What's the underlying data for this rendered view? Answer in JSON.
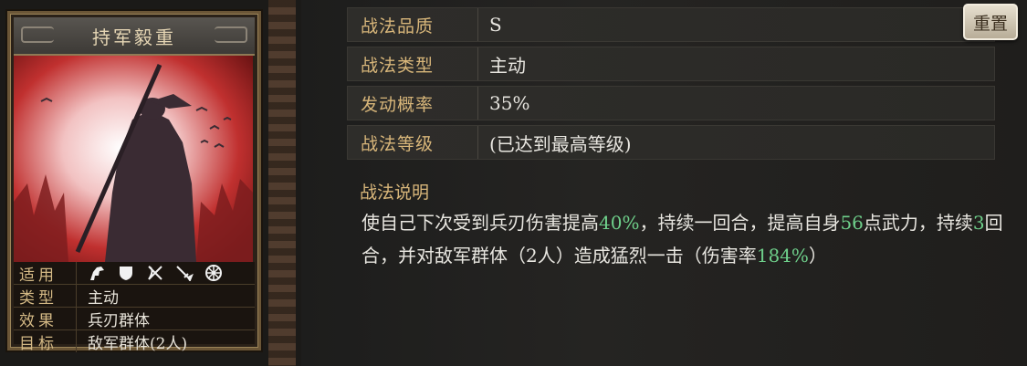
{
  "card": {
    "title": "持军毅重",
    "stats": [
      {
        "key": "适用",
        "value": ""
      },
      {
        "key": "类型",
        "value": "主动"
      },
      {
        "key": "效果",
        "value": "兵刃群体"
      },
      {
        "key": "目标",
        "value": "敌军群体(2人)"
      }
    ],
    "unit_icons": [
      "cavalry-icon",
      "shield-icon",
      "bow-icon",
      "spear-icon",
      "chariot-wheel-icon"
    ]
  },
  "details": {
    "rows": [
      {
        "key": "战法品质",
        "value": "S"
      },
      {
        "key": "战法类型",
        "value": "主动"
      },
      {
        "key": "发动概率",
        "value": "35%"
      },
      {
        "key": "战法等级",
        "value": "(已达到最高等级)"
      }
    ],
    "reset_label": "重置",
    "desc_title": "战法说明",
    "desc": [
      {
        "t": "使自己下次受到兵刃伤害提高",
        "hl": false
      },
      {
        "t": "40%",
        "hl": true
      },
      {
        "t": "，持续一回合，提高自身",
        "hl": false
      },
      {
        "t": "56",
        "hl": true
      },
      {
        "t": "点武力，持续",
        "hl": false
      },
      {
        "t": "3",
        "hl": true
      },
      {
        "t": "回合，并对敌军群体（2人）造成猛烈一击（伤害率",
        "hl": false
      },
      {
        "t": "184%",
        "hl": true
      },
      {
        "t": "）",
        "hl": false
      }
    ]
  },
  "colors": {
    "label_gold": "#d8b67a",
    "highlight_green": "#6ecf8a",
    "art_red": "#c0302f"
  }
}
